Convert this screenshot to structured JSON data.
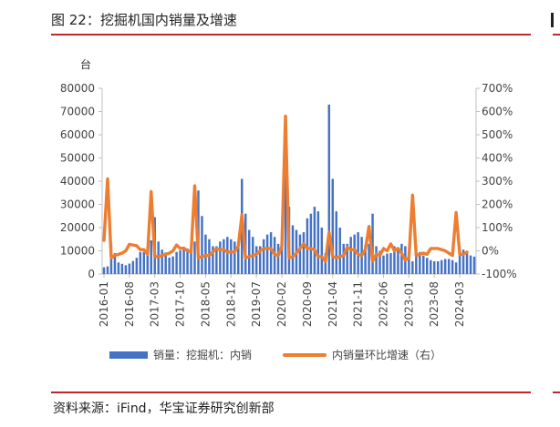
{
  "title": "图 22：挖掘机国内销量及增速",
  "unit_left": "台",
  "source": "资料来源：iFind，华宝证券研究创新部",
  "colors": {
    "bar": "#4472c4",
    "line": "#ed7d31",
    "accent": "#c0262d"
  },
  "legend": {
    "bar_label": "销量：挖掘机：内销",
    "line_label": "内销量环比增速（右）"
  },
  "chart_data": {
    "type": "bar",
    "title": "",
    "xlabel": "",
    "ylabel": "台",
    "ylim": [
      0,
      80000
    ],
    "y2lim": [
      -100,
      700
    ],
    "y_ticks": [
      "0",
      "10000",
      "20000",
      "30000",
      "40000",
      "50000",
      "60000",
      "70000",
      "80000"
    ],
    "y2_ticks": [
      "-100%",
      "0%",
      "100%",
      "200%",
      "300%",
      "400%",
      "500%",
      "600%",
      "700%"
    ],
    "x_tick_labels": [
      "2016-01",
      "2016-08",
      "2017-03",
      "2017-10",
      "2018-05",
      "2018-12",
      "2019-07",
      "2020-02",
      "2020-09",
      "2021-04",
      "2021-11",
      "2022-06",
      "2023-01",
      "2023-08",
      "2024-03"
    ],
    "x_tick_every": 7,
    "start": "2016-01",
    "series": [
      {
        "name": "销量：挖掘机：内销",
        "type": "bar",
        "axis": "left",
        "values": [
          2900,
          3300,
          13000,
          9000,
          5000,
          4400,
          3800,
          4500,
          5600,
          7000,
          9500,
          9500,
          8000,
          14500,
          24500,
          14000,
          10500,
          9300,
          7100,
          7600,
          9500,
          10200,
          11500,
          11000,
          11000,
          14000,
          36000,
          25000,
          17000,
          15000,
          12000,
          12000,
          14000,
          15000,
          16000,
          15000,
          14000,
          14000,
          41000,
          26000,
          19000,
          16000,
          12000,
          12000,
          15000,
          17000,
          18000,
          16000,
          13000,
          12000,
          43000,
          29000,
          21000,
          19000,
          17000,
          18000,
          24000,
          26000,
          29000,
          27000,
          20000,
          9000,
          73000,
          41000,
          27000,
          20000,
          13000,
          13000,
          16000,
          17000,
          18000,
          16000,
          12500,
          13000,
          26000,
          12000,
          10000,
          8000,
          8800,
          9000,
          12000,
          11500,
          13000,
          12000,
          7500,
          5500,
          12000,
          9500,
          8000,
          7000,
          6000,
          5500,
          5500,
          6000,
          6500,
          6500,
          6000,
          5000,
          11500,
          10500,
          9000,
          8000,
          7500
        ]
      },
      {
        "name": "内销量环比增速（右）",
        "type": "line",
        "axis": "right",
        "values": [
          45,
          310,
          -30,
          -20,
          -15,
          -10,
          0,
          28,
          25,
          22,
          5,
          5,
          -15,
          255,
          -25,
          -25,
          -20,
          -15,
          -10,
          0,
          25,
          10,
          12,
          0,
          -5,
          280,
          -30,
          -25,
          -20,
          -20,
          -5,
          10,
          5,
          5,
          -5,
          -5,
          -5,
          20,
          155,
          -30,
          -25,
          -20,
          -15,
          0,
          10,
          10,
          10,
          -15,
          -20,
          20,
          580,
          -30,
          -25,
          -10,
          10,
          30,
          10,
          10,
          5,
          -25,
          -25,
          -45,
          80,
          -25,
          -30,
          -25,
          -20,
          15,
          5,
          5,
          -15,
          -20,
          5,
          105,
          -45,
          -15,
          -20,
          10,
          0,
          30,
          0,
          10,
          -10,
          -40,
          -30,
          240,
          -20,
          -15,
          -10,
          -15,
          10,
          10,
          10,
          5,
          0,
          -10,
          -20,
          165,
          -15,
          -15,
          -5
        ]
      }
    ]
  }
}
